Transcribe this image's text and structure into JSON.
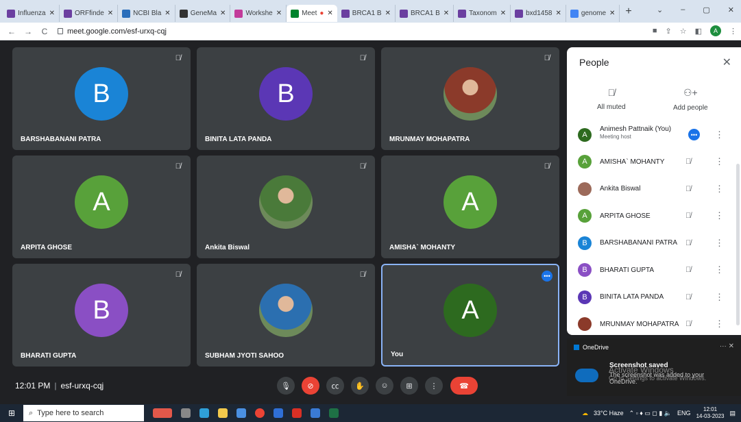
{
  "tabs": [
    {
      "label": "Influenza",
      "color": "#6b3fa0"
    },
    {
      "label": "ORFfinde",
      "color": "#6b3fa0"
    },
    {
      "label": "NCBI Bla",
      "color": "#2a6ebb"
    },
    {
      "label": "GeneMa",
      "color": "#333333"
    },
    {
      "label": "Workshe",
      "color": "#c23b9a"
    },
    {
      "label": "Meet",
      "color": "#00832d",
      "active": true
    },
    {
      "label": "BRCA1 B",
      "color": "#6b3fa0"
    },
    {
      "label": "BRCA1 B",
      "color": "#6b3fa0"
    },
    {
      "label": "Taxonom",
      "color": "#6b3fa0"
    },
    {
      "label": "bxd1458",
      "color": "#6b3fa0"
    },
    {
      "label": "genome",
      "color": "#4285f4"
    }
  ],
  "address": {
    "url": "meet.google.com/esf-urxq-cqj",
    "profile_initial": "A"
  },
  "tiles": [
    {
      "name": "BARSHABANANI PATRA",
      "initial": "B",
      "color": "#1a84d6",
      "photo": false
    },
    {
      "name": "BINITA LATA PANDA",
      "initial": "B",
      "color": "#5b37b5",
      "photo": false
    },
    {
      "name": "MRUNMAY MOHAPATRA",
      "initial": "",
      "color": "#8b3a2a",
      "photo": true
    },
    {
      "name": "ARPITA GHOSE",
      "initial": "A",
      "color": "#58a13a",
      "photo": false
    },
    {
      "name": "Ankita Biswal",
      "initial": "",
      "color": "#4a7a3a",
      "photo": true
    },
    {
      "name": "AMISHA` MOHANTY",
      "initial": "A",
      "color": "#58a13a",
      "photo": false
    },
    {
      "name": "BHARATI GUPTA",
      "initial": "B",
      "color": "#8a4fc4",
      "photo": false
    },
    {
      "name": "SUBHAM JYOTI SAHOO",
      "initial": "",
      "color": "#2b6fb0",
      "photo": true
    },
    {
      "name": "You",
      "initial": "A",
      "color": "#2d6a1f",
      "photo": false
    }
  ],
  "people": {
    "title": "People",
    "all_muted": "All muted",
    "add_people": "Add people",
    "list": [
      {
        "name": "Animesh Pattnaik (You)",
        "sub": "Meeting host",
        "initial": "A",
        "color": "#2d6a1f"
      },
      {
        "name": "AMISHA` MOHANTY",
        "sub": "",
        "initial": "A",
        "color": "#58a13a"
      },
      {
        "name": "Ankita Biswal",
        "sub": "",
        "initial": "",
        "color": "#9c6a5a"
      },
      {
        "name": "ARPITA GHOSE",
        "sub": "",
        "initial": "A",
        "color": "#58a13a"
      },
      {
        "name": "BARSHABANANI PATRA",
        "sub": "",
        "initial": "B",
        "color": "#1a84d6"
      },
      {
        "name": "BHARATI GUPTA",
        "sub": "",
        "initial": "B",
        "color": "#8a4fc4"
      },
      {
        "name": "BINITA LATA PANDA",
        "sub": "",
        "initial": "B",
        "color": "#5b37b5"
      },
      {
        "name": "MRUNMAY MOHAPATRA",
        "sub": "",
        "initial": "",
        "color": "#8b3a2a"
      }
    ]
  },
  "meeting": {
    "time": "12:01 PM",
    "code": "esf-urxq-cqj"
  },
  "toast": {
    "app": "OneDrive",
    "title": "Screenshot saved",
    "body": "The screenshot was added to your OneDrive."
  },
  "watermark": {
    "line1": "Activate Windows",
    "line2": "Go to Settings to activate Windows."
  },
  "taskbar": {
    "search_placeholder": "Type here to search",
    "weather": "33°C Haze",
    "lang": "ENG",
    "time": "12:01",
    "date": "14-03-2023"
  }
}
